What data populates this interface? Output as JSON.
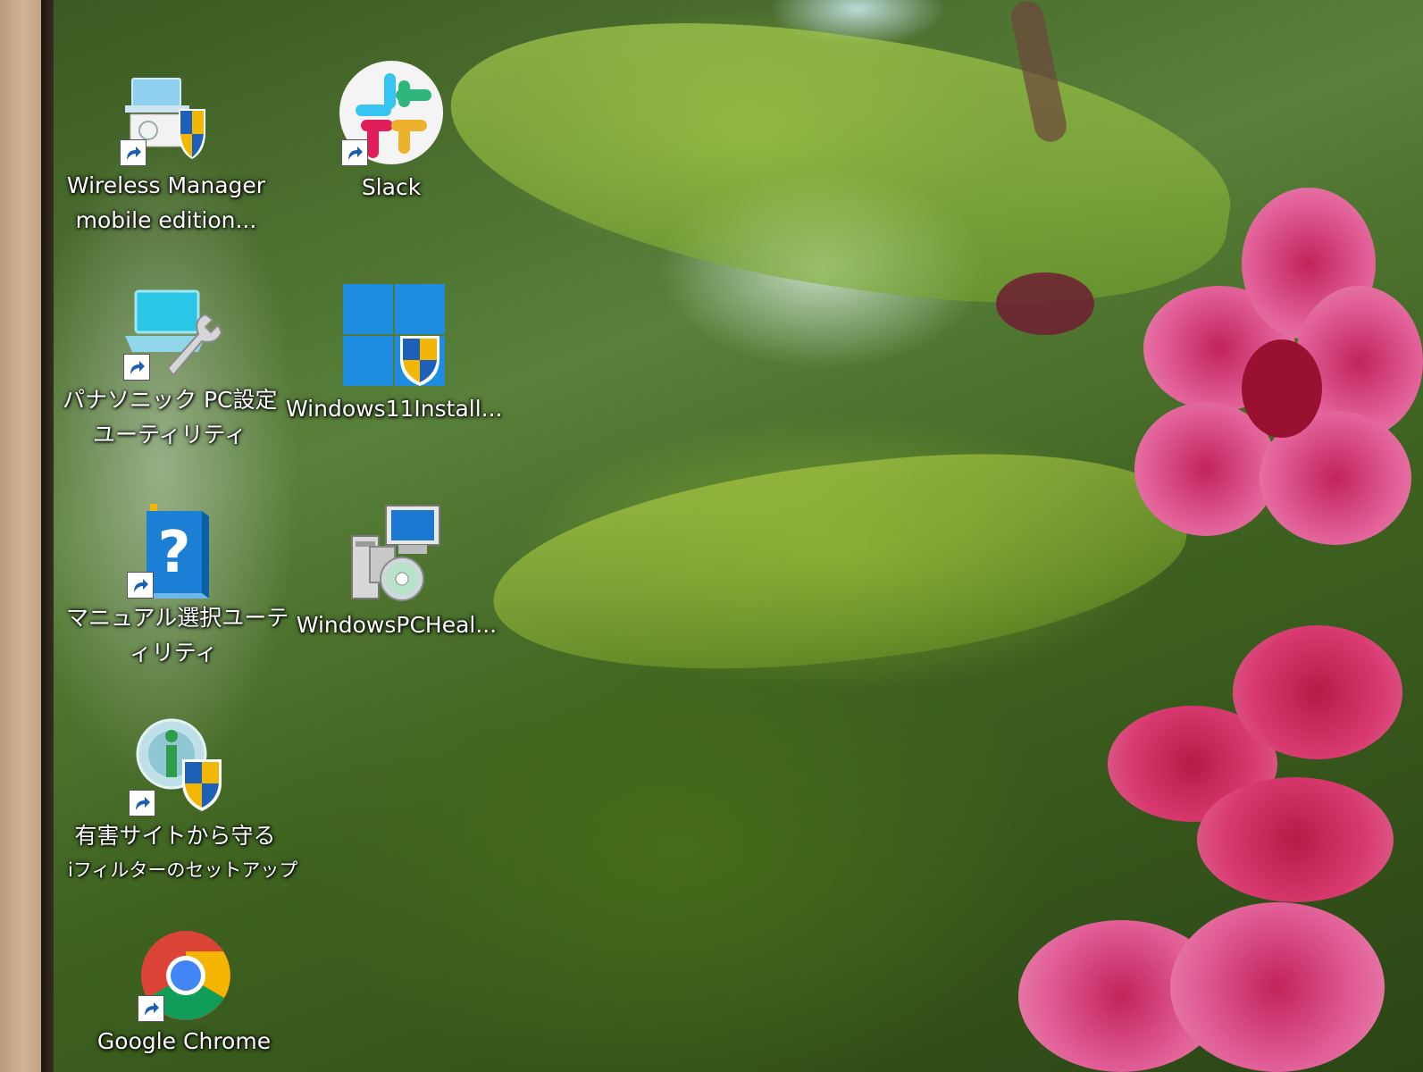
{
  "desktop": {
    "icons": [
      {
        "label_line1": "Wireless Manager",
        "label_line2": "mobile edition...",
        "icon": "wireless-manager-icon"
      },
      {
        "label_line1": "Slack",
        "label_line2": "",
        "icon": "slack-icon"
      },
      {
        "label_line1": "パナソニック PC設定",
        "label_line2": "ユーティリティ",
        "icon": "pc-settings-utility-icon"
      },
      {
        "label_line1": "Windows11Install...",
        "label_line2": "",
        "icon": "windows11-installer-icon"
      },
      {
        "label_line1": "マニュアル選択ユーテ",
        "label_line2": "ィリティ",
        "icon": "manual-help-icon"
      },
      {
        "label_line1": "WindowsPCHeal...",
        "label_line2": "",
        "icon": "setup-installer-icon"
      },
      {
        "label_line1": "有害サイトから守る",
        "label_line2": "iフィルターのセットアップ",
        "icon": "ifilter-setup-icon"
      },
      {
        "label_line1": "Google Chrome",
        "label_line2": "",
        "icon": "chrome-icon"
      }
    ]
  },
  "colors": {
    "label_text": "#ffffff",
    "windows_blue": "#1e8de0",
    "shield_blue": "#1e5fb8",
    "shield_yellow": "#f2b705",
    "slack_blue": "#36c5f0",
    "slack_green": "#2eb67d",
    "slack_red": "#e01e5a",
    "slack_yellow": "#ecb22e",
    "flower_pink": "#e05a93"
  }
}
